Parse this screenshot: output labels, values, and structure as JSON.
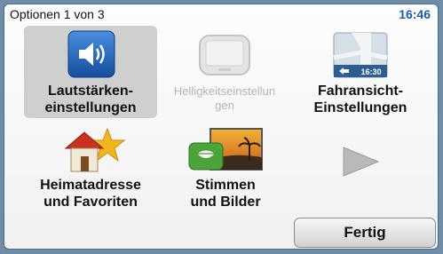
{
  "header": {
    "title": "Optionen 1 von 3",
    "clock": "16:46"
  },
  "menu": {
    "volume": {
      "line1": "Lautstärken-",
      "line2": "einstellungen",
      "icon": "speaker-icon",
      "selected": true
    },
    "brightness": {
      "line1": "Helligkeitseinstellun",
      "line2": "gen",
      "icon": "device-icon",
      "enabled": false
    },
    "view": {
      "line1": "Fahransicht-",
      "line2": "Einstellungen",
      "icon": "map-view-icon",
      "map_time": "16:30"
    },
    "home": {
      "line1": "Heimatadresse",
      "line2": "und Favoriten",
      "icon": "house-star-icon"
    },
    "voices": {
      "line1": "Stimmen",
      "line2": "und Bilder",
      "icon": "lips-picture-icon"
    },
    "next": {
      "icon": "next-arrow-icon"
    }
  },
  "footer": {
    "done_label": "Fertig"
  },
  "colors": {
    "clock": "#1a5fa6",
    "volume_icon": "#1f5fae",
    "frame": "#6f8da8"
  }
}
